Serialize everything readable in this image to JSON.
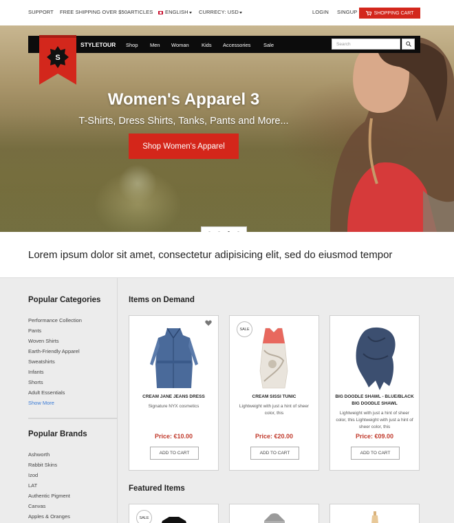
{
  "topbar": {
    "support": "SUPPORT",
    "shipping": "FREE SHIPPING OVER $50",
    "articles": "ARTICLES",
    "language": "ENGLISH",
    "currency": "CURRECY: USD",
    "login": "LOGIN",
    "signup": "SINGUP",
    "cart": "SHOPPING CART"
  },
  "nav": {
    "brand": "STYLETOUR",
    "links": [
      "Shop",
      "Men",
      "Woman",
      "Kids",
      "Accessories",
      "Sale"
    ],
    "search_placeholder": "Search"
  },
  "hero": {
    "title": "Women's Apparel 3",
    "subtitle": "T-Shirts, Dress Shirts, Tanks, Pants and More...",
    "button": "Shop Women's Apparel",
    "slides": 4,
    "active_slide": 3
  },
  "lorem": "Lorem ipsum dolor sit amet, consectetur adipisicing elit, sed do eiusmod tempor",
  "sidebar": {
    "categories_title": "Popular Categories",
    "categories": [
      "Performance Collection",
      "Pants",
      "Woven Shirts",
      "Earth-Friendly Apparel",
      "Sweatshirts",
      "Infants",
      "Shorts",
      "Adult Essentials"
    ],
    "show_more": "Show More",
    "brands_title": "Popular Brands",
    "brands": [
      "Ashworth",
      "Rabbit Skins",
      "Izod",
      "LAT",
      "Authentic Pigment",
      "Canvas",
      "Apples & Oranges"
    ]
  },
  "main": {
    "demand_title": "Items on Demand",
    "featured_title": "Featured Items",
    "sale_badge": "SALE",
    "add_to_cart": "ADD TO CART",
    "products": [
      {
        "name": "CREAM JANE JEANS DRESS",
        "desc": "Signature NYX cosmetics",
        "price": "Price: €10.00"
      },
      {
        "name": "CREAM SISSI TUNIC",
        "desc": "Lightweight with just a hint of sheer color, this",
        "price": "Price: €20.00"
      },
      {
        "name": "BIG DOODLE SHAWL - BLUE/BLACK BIG DOODLE SHAWL",
        "desc": "Lightweight with just a hint of sheer color, this Lightweight with just a hint of sheer color, this",
        "price": "Price: €09.00"
      }
    ]
  },
  "colors": {
    "accent": "#d3271c",
    "price": "#c0392b",
    "link": "#3a7bd5"
  }
}
